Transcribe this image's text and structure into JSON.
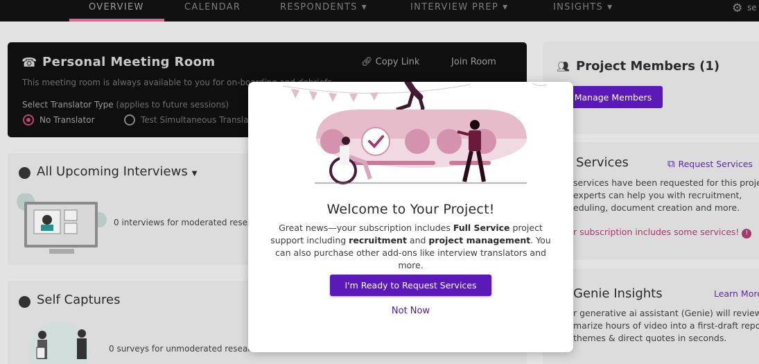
{
  "nav": {
    "items": [
      "OVERVIEW",
      "CALENDAR",
      "RESPONDENTS",
      "INTERVIEW PREP",
      "INSIGHTS"
    ],
    "active": "OVERVIEW",
    "settings_label": "se"
  },
  "meeting": {
    "title": "Personal Meeting Room",
    "description": "This meeting room is always available to you for on-boarding and debriefs.",
    "copy_link": "Copy Link",
    "join_room": "Join Room",
    "translator_label": "Select Translator Type",
    "translator_note": "(applies to future sessions)",
    "options": [
      "No Translator",
      "Test Simultaneous Translator"
    ],
    "selected": "No Translator"
  },
  "upcoming": {
    "title": "All Upcoming Interviews",
    "empty": "0 interviews for moderated research"
  },
  "selfcap": {
    "title": "Self Captures",
    "empty": "0 surveys for unmoderated research"
  },
  "members": {
    "title": "Project Members (1)",
    "manage_button": "Manage Members"
  },
  "services": {
    "title": "Services",
    "request_link": "Request Services",
    "line1": "services have been requested for this project",
    "line2": "experts can help you with recruitment,",
    "line3": "eduling, document creation and more.",
    "note": "r subscription includes some services!"
  },
  "genie": {
    "title": "Genie Insights",
    "learn_more": "Learn More",
    "line1": "r generative ai assistant (Genie) will review a",
    "line2": "marize hours of video into a first-draft report",
    "line3": "themes & direct quotes in seconds."
  },
  "modal": {
    "title": "Welcome to Your Project!",
    "p1": "Great news—your subscription includes ",
    "b1": "Full Service",
    "p2": " project support including ",
    "b2": "recruitment",
    "p3": " and ",
    "b3": "project management",
    "p4": ". You can also purchase other add-ons like interview translators and more.",
    "primary_button": "I'm Ready to Request Services",
    "secondary_button": "Not Now"
  },
  "colors": {
    "accent": "#5b1ab8",
    "pink": "#d46a9a",
    "brand_dark": "#0f0f0f"
  }
}
